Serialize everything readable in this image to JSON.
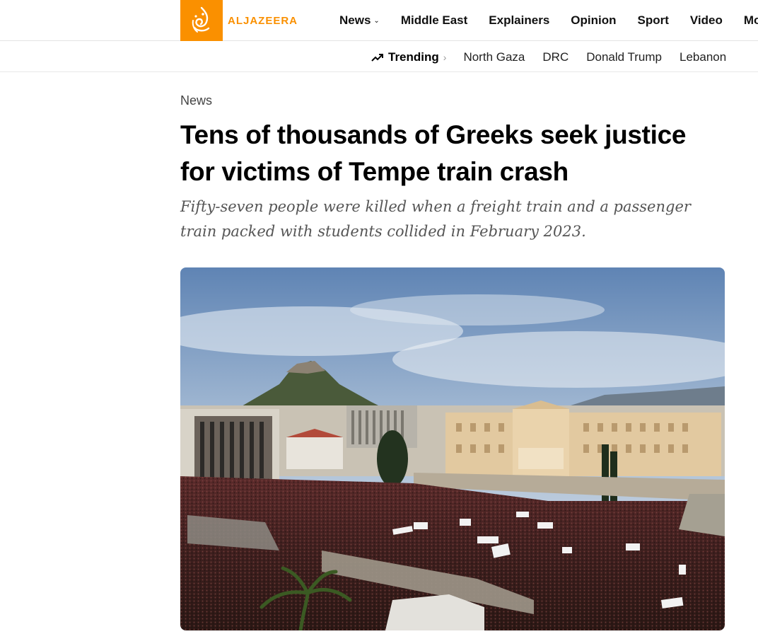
{
  "brand": {
    "name": "ALJAZEERA",
    "accent_color": "#fa9000",
    "logo_icon": "aljazeera-calligraphy-logo"
  },
  "nav": {
    "items": [
      {
        "label": "News",
        "has_dropdown": true
      },
      {
        "label": "Middle East"
      },
      {
        "label": "Explainers"
      },
      {
        "label": "Opinion"
      },
      {
        "label": "Sport"
      },
      {
        "label": "Video"
      },
      {
        "label": "Mo"
      }
    ]
  },
  "trending": {
    "label": "Trending",
    "icon": "trending-up-icon",
    "links": [
      "North Gaza",
      "DRC",
      "Donald Trump",
      "Lebanon"
    ]
  },
  "article": {
    "category": "News",
    "headline_line1": "Tens of thousands of Greeks seek justice",
    "headline_line2": "for victims of Tempe train crash",
    "dek_line1": "Fifty-seven people were killed when a freight train and a passenger",
    "dek_line2": "train packed with students collided in February 2023."
  }
}
